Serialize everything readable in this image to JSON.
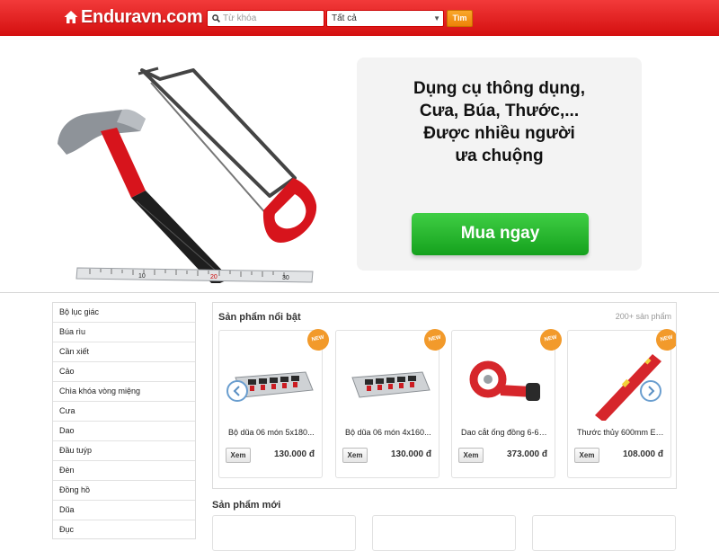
{
  "header": {
    "logo_text": "Enduravn.com",
    "logo_icon": "home-icon",
    "search": {
      "placeholder": "Từ khóa",
      "icon": "search-icon"
    },
    "category_select": {
      "selected": "Tất cả"
    },
    "search_button_label": "Tìm",
    "colors": {
      "bar": "#e21b1b",
      "button": "#f39314"
    }
  },
  "hero": {
    "lines": [
      "Dụng cụ thông dụng,",
      "Cưa, Búa, Thước,...",
      "Được nhiều người",
      "ưa chuộng"
    ],
    "cta_label": "Mua ngay",
    "ruler_labels": [
      "10",
      "20",
      "30"
    ],
    "colors": {
      "cta": "#22b02a",
      "card": "#f3f3f3"
    }
  },
  "sidebar": {
    "items": [
      "Bộ lục giác",
      "Búa rìu",
      "Cần xiết",
      "Cảo",
      "Chìa khóa vòng miệng",
      "Cưa",
      "Dao",
      "Đầu tuýp",
      "Đèn",
      "Đồng hồ",
      "Dũa",
      "Đục"
    ]
  },
  "featured": {
    "title": "Sản phẩm nổi bật",
    "count": "200+ sản phẩm",
    "badge": "NEW",
    "view_label": "Xem",
    "products": [
      {
        "name": "Bộ dũa 06 món 5x180...",
        "price": "130.000 đ"
      },
      {
        "name": "Bộ dũa 06 món 4x160...",
        "price": "130.000 đ"
      },
      {
        "name": "Dao cắt ống đồng 6-67...",
        "price": "373.000 đ"
      },
      {
        "name": "Thước thủy 600mm En...",
        "price": "108.000 đ"
      }
    ]
  },
  "new_products": {
    "title": "Sản phẩm mới"
  }
}
